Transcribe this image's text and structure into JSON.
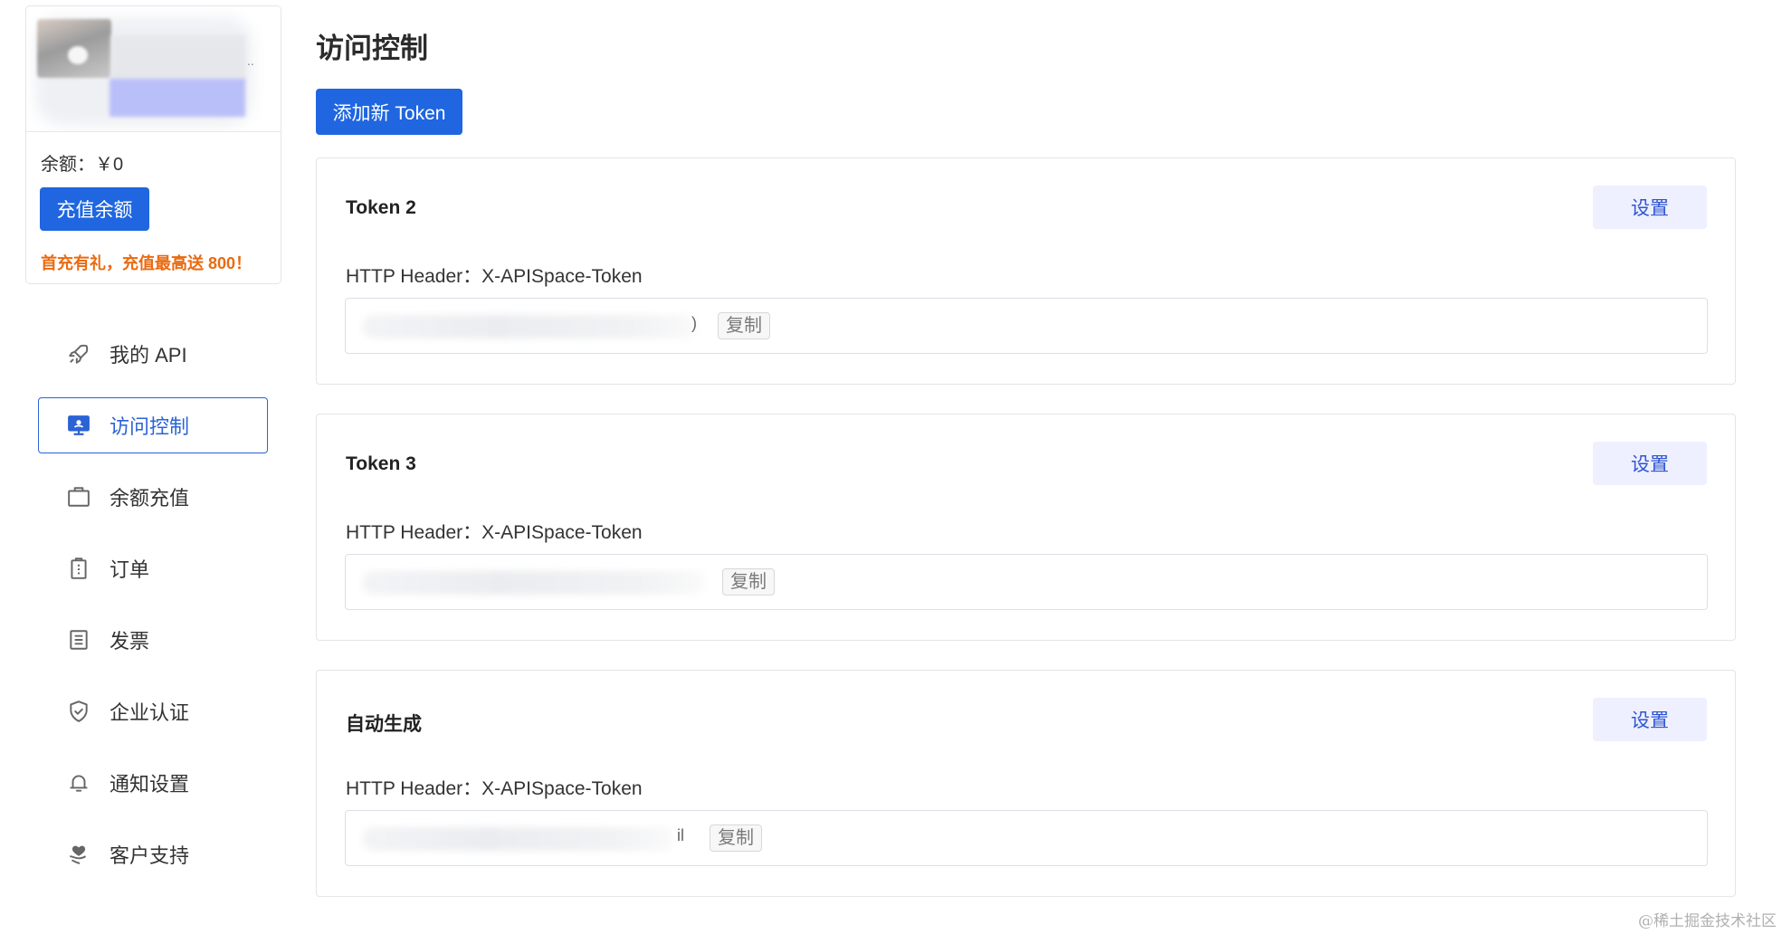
{
  "account": {
    "balance_text": "余额：￥0",
    "recharge_label": "充值余额",
    "promo_text": "首充有礼，充值最高送 800！",
    "ellipsis": ".."
  },
  "nav": {
    "items": [
      {
        "label": "我的 API",
        "icon": "rocket-icon",
        "active": false
      },
      {
        "label": "访问控制",
        "icon": "monitor-icon",
        "active": true
      },
      {
        "label": "余额充值",
        "icon": "wallet-icon",
        "active": false
      },
      {
        "label": "订单",
        "icon": "clipboard-icon",
        "active": false
      },
      {
        "label": "发票",
        "icon": "invoice-icon",
        "active": false
      },
      {
        "label": "企业认证",
        "icon": "shield-icon",
        "active": false
      },
      {
        "label": "通知设置",
        "icon": "bell-icon",
        "active": false
      },
      {
        "label": "客户支持",
        "icon": "heart-hand-icon",
        "active": false
      }
    ]
  },
  "main": {
    "title": "访问控制",
    "add_token_label": "添加新 Token",
    "tokens": [
      {
        "name": "Token 2",
        "settings_label": "设置",
        "header_text": "HTTP Header：X-APISpace-Token",
        "value_tail": ")",
        "copy_label": "复制"
      },
      {
        "name": "Token 3",
        "settings_label": "设置",
        "header_text": "HTTP Header：X-APISpace-Token",
        "value_tail": "",
        "copy_label": "复制"
      },
      {
        "name": "自动生成",
        "settings_label": "设置",
        "header_text": "HTTP Header：X-APISpace-Token",
        "value_tail": "il",
        "copy_label": "复制"
      }
    ]
  },
  "watermark": "@稀土掘金技术社区",
  "colors": {
    "primary": "#1f66e0",
    "active_nav": "#2b63d6",
    "settings_bg": "#eeefff",
    "promo": "#ea6a10"
  }
}
